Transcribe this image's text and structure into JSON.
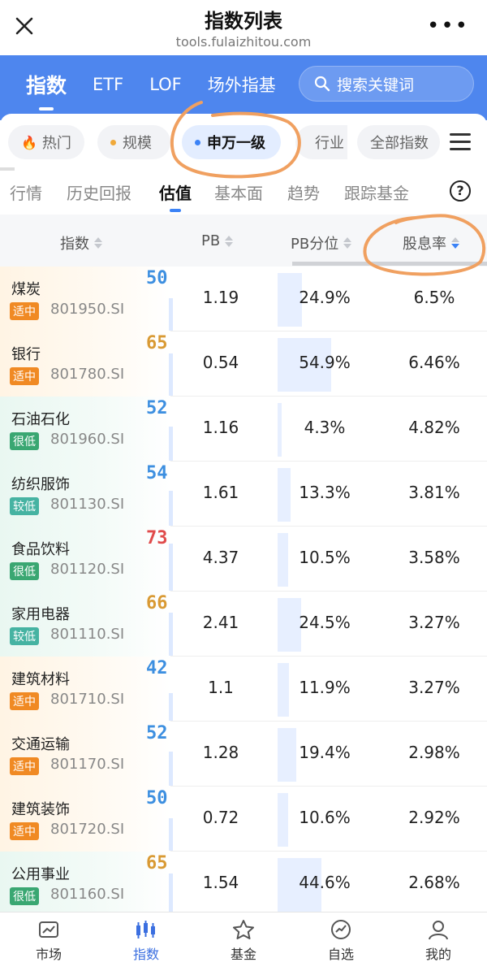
{
  "window": {
    "title": "指数列表",
    "url": "tools.fulaizhitou.com"
  },
  "main_tabs": [
    {
      "label": "指数",
      "active": true
    },
    {
      "label": "ETF"
    },
    {
      "label": "LOF"
    },
    {
      "label": "场外指基"
    }
  ],
  "search": {
    "placeholder": "搜索关键词"
  },
  "chips": [
    {
      "label": "热门",
      "icon": "fire-icon"
    },
    {
      "label": "规模"
    },
    {
      "label": "申万一级",
      "active": true
    },
    {
      "label": "行业"
    },
    {
      "label": "全部指数"
    }
  ],
  "sub_tabs": [
    {
      "label": "行情"
    },
    {
      "label": "历史回报"
    },
    {
      "label": "估值",
      "active": true
    },
    {
      "label": "基本面"
    },
    {
      "label": "趋势"
    },
    {
      "label": "跟踪基金"
    }
  ],
  "table": {
    "headers": {
      "index": "指数",
      "pb": "PB",
      "pb_pct": "PB分位",
      "dividend": "股息率"
    },
    "rows": [
      {
        "name": "煤炭",
        "tag": "适中",
        "code": "801950.SI",
        "score": "50",
        "pb": "1.19",
        "pb_pct": "24.9%",
        "dividend": "6.5%"
      },
      {
        "name": "银行",
        "tag": "适中",
        "code": "801780.SI",
        "score": "65",
        "pb": "0.54",
        "pb_pct": "54.9%",
        "dividend": "6.46%"
      },
      {
        "name": "石油石化",
        "tag": "很低",
        "code": "801960.SI",
        "score": "52",
        "pb": "1.16",
        "pb_pct": "4.3%",
        "dividend": "4.82%"
      },
      {
        "name": "纺织服饰",
        "tag": "较低",
        "code": "801130.SI",
        "score": "54",
        "pb": "1.61",
        "pb_pct": "13.3%",
        "dividend": "3.81%"
      },
      {
        "name": "食品饮料",
        "tag": "很低",
        "code": "801120.SI",
        "score": "73",
        "pb": "4.37",
        "pb_pct": "10.5%",
        "dividend": "3.58%"
      },
      {
        "name": "家用电器",
        "tag": "较低",
        "code": "801110.SI",
        "score": "66",
        "pb": "2.41",
        "pb_pct": "24.5%",
        "dividend": "3.27%"
      },
      {
        "name": "建筑材料",
        "tag": "适中",
        "code": "801710.SI",
        "score": "42",
        "pb": "1.1",
        "pb_pct": "11.9%",
        "dividend": "3.27%"
      },
      {
        "name": "交通运输",
        "tag": "适中",
        "code": "801170.SI",
        "score": "52",
        "pb": "1.28",
        "pb_pct": "19.4%",
        "dividend": "2.98%"
      },
      {
        "name": "建筑装饰",
        "tag": "适中",
        "code": "801720.SI",
        "score": "50",
        "pb": "0.72",
        "pb_pct": "10.6%",
        "dividend": "2.92%"
      },
      {
        "name": "公用事业",
        "tag": "很低",
        "code": "801160.SI",
        "score": "65",
        "pb": "1.54",
        "pb_pct": "44.6%",
        "dividend": "2.68%"
      }
    ]
  },
  "bottom_nav": [
    {
      "label": "市场",
      "icon": "market-icon"
    },
    {
      "label": "指数",
      "icon": "index-icon",
      "active": true
    },
    {
      "label": "基金",
      "icon": "fund-icon"
    },
    {
      "label": "自选",
      "icon": "watchlist-icon"
    },
    {
      "label": "我的",
      "icon": "profile-icon"
    }
  ],
  "colors": {
    "brand_blue": "#4e86ee",
    "tag_mid": "#f08a24",
    "tag_very_low": "#3aa772",
    "tag_low": "#46b3a2",
    "annotation_orange": "#f0a060"
  }
}
